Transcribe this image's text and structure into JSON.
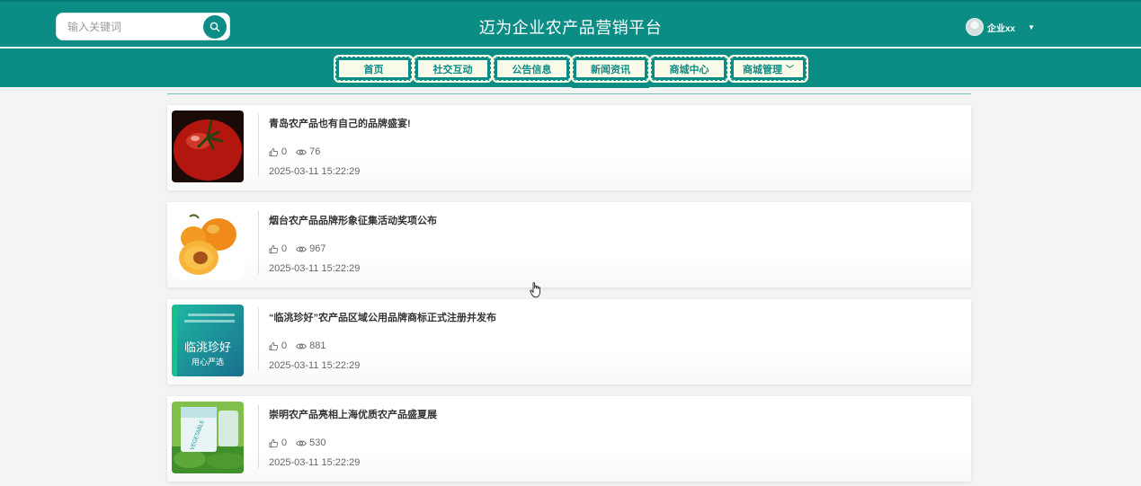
{
  "header": {
    "search": {
      "placeholder": "输入关键词"
    },
    "title": "迈为企业农产品营销平台",
    "user": {
      "name": "企业xx"
    }
  },
  "nav": {
    "tabs": [
      {
        "label": "首页"
      },
      {
        "label": "社交互动"
      },
      {
        "label": "公告信息"
      },
      {
        "label": "新闻资讯",
        "active": true
      },
      {
        "label": "商城中心"
      },
      {
        "label": "商城管理",
        "has_dropdown": true
      }
    ]
  },
  "news": [
    {
      "title": "青岛农产品也有自己的品牌盛宴!",
      "likes": "0",
      "views": "76",
      "date": "2025-03-11 15:22:29"
    },
    {
      "title": "烟台农产品品牌形象征集活动奖项公布",
      "likes": "0",
      "views": "967",
      "date": "2025-03-11 15:22:29"
    },
    {
      "title": "“临洮珍好”农产品区域公用品牌商标正式注册并发布",
      "likes": "0",
      "views": "881",
      "date": "2025-03-11 15:22:29"
    },
    {
      "title": "崇明农产品亮相上海优质农产品盛夏展",
      "likes": "0",
      "views": "530",
      "date": "2025-03-11 15:22:29"
    }
  ],
  "thumb_text": {
    "img3_main": "临洮珍好",
    "img3_sub": "用心严选",
    "img4_pack": "VEGETABLE"
  },
  "colors": {
    "primary": "#0b8c85",
    "tab_bg": "#fbfbea"
  }
}
